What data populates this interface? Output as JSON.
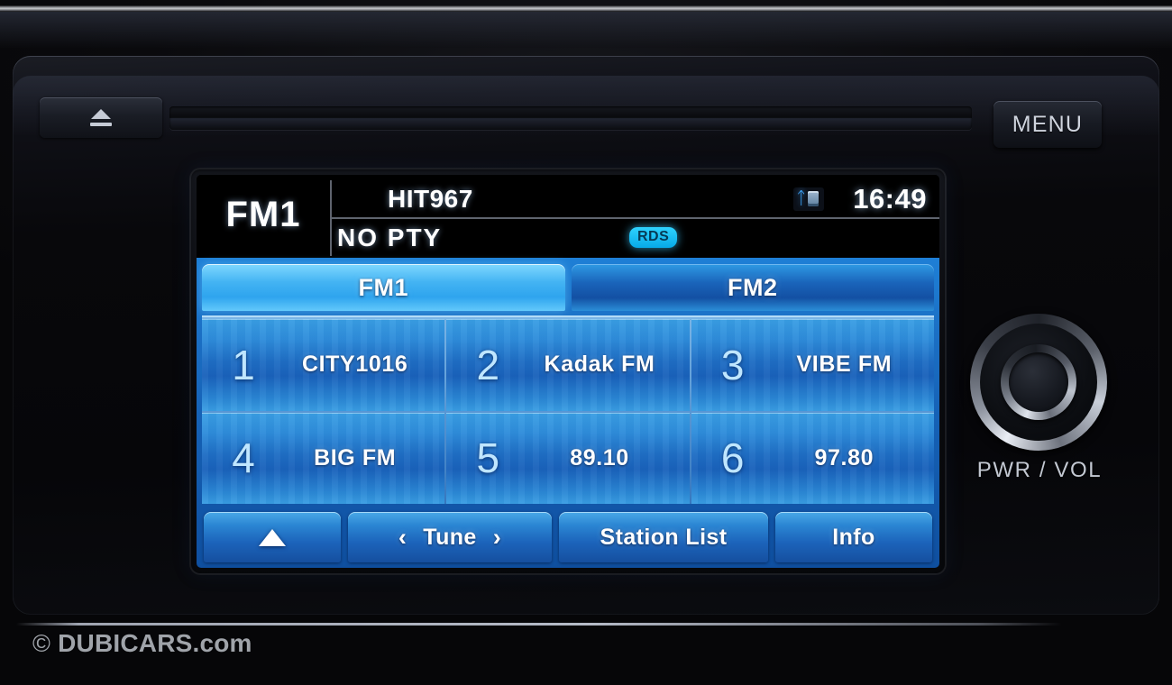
{
  "device": {
    "eject_button_icon": "eject-icon",
    "menu_button_label": "MENU",
    "knob_label": "PWR / VOL"
  },
  "screen": {
    "status": {
      "band": "FM1",
      "station_name": "HIT967",
      "pty": "NO PTY",
      "rds_badge": "RDS",
      "bluetooth_icon": "bluetooth-phone-icon",
      "clock": "16:49"
    },
    "tabs": [
      {
        "label": "FM1",
        "active": true
      },
      {
        "label": "FM2",
        "active": false
      }
    ],
    "presets": [
      {
        "number": "1",
        "name": "CITY1016"
      },
      {
        "number": "2",
        "name": "Kadak FM"
      },
      {
        "number": "3",
        "name": "VIBE FM"
      },
      {
        "number": "4",
        "name": "BIG FM"
      },
      {
        "number": "5",
        "name": "89.10"
      },
      {
        "number": "6",
        "name": "97.80"
      }
    ],
    "buttons": {
      "up_icon": "up-arrow-icon",
      "tune_prev_icon": "‹",
      "tune_label": "Tune",
      "tune_next_icon": "›",
      "station_list_label": "Station List",
      "info_label": "Info"
    }
  },
  "watermark": {
    "copyright_symbol": "©",
    "text": "DUBICARS.com"
  },
  "colors": {
    "screen_blue": "#1b6fc4",
    "tab_active": "#44b4f3",
    "tab_inactive": "#1a64ba",
    "rds_cyan": "#07a9e8",
    "bluetooth_blue": "#3ea8ff",
    "bezel_black": "#08080b"
  }
}
